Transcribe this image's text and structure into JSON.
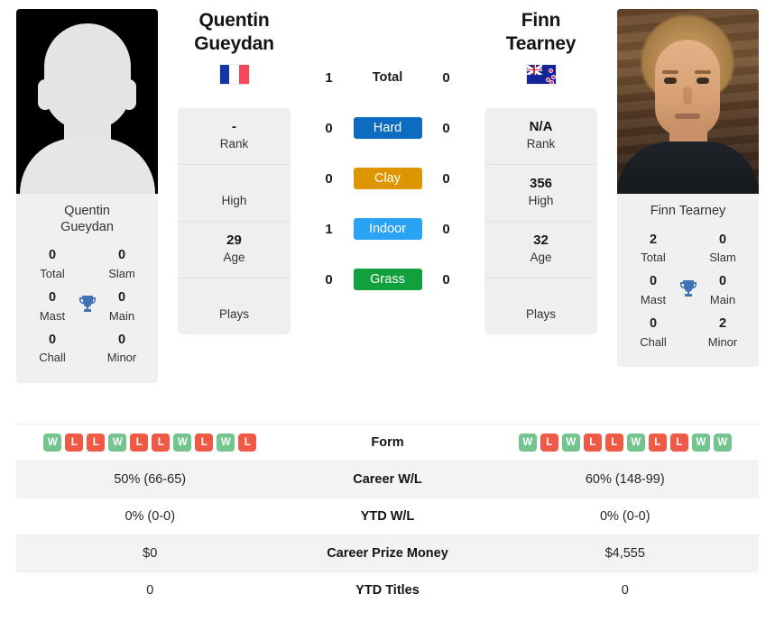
{
  "players": {
    "left": {
      "name": "Quentin Gueydan",
      "name_line1": "Quentin",
      "name_line2": "Gueydan",
      "photo_caption_line1": "Quentin",
      "photo_caption_line2": "Gueydan",
      "flag": "fr-flag-icon",
      "avatar": "placeholder-avatar-icon",
      "rank": "-",
      "rank_label": "Rank",
      "high": "",
      "high_label": "High",
      "age": "29",
      "age_label": "Age",
      "plays": "",
      "plays_label": "Plays",
      "titles": {
        "total": "0",
        "total_label": "Total",
        "slam": "0",
        "slam_label": "Slam",
        "mast": "0",
        "mast_label": "Mast",
        "main": "0",
        "main_label": "Main",
        "chall": "0",
        "chall_label": "Chall",
        "minor": "0",
        "minor_label": "Minor"
      },
      "titles_by_surface": {
        "total": "1",
        "hard": "0",
        "clay": "0",
        "indoor": "1",
        "grass": "0"
      },
      "form": [
        "W",
        "L",
        "L",
        "W",
        "L",
        "L",
        "W",
        "L",
        "W",
        "L"
      ],
      "career_wl": "50% (66-65)",
      "ytd_wl": "0% (0-0)",
      "career_prize_money": "$0",
      "ytd_titles": "0"
    },
    "right": {
      "name": "Finn Tearney",
      "name_line1": "Finn Tearney",
      "name_line2": "",
      "photo_caption_line1": "Finn Tearney",
      "photo_caption_line2": "",
      "flag": "nz-flag-icon",
      "avatar": "player-photo",
      "rank": "N/A",
      "rank_label": "Rank",
      "high": "356",
      "high_label": "High",
      "age": "32",
      "age_label": "Age",
      "plays": "",
      "plays_label": "Plays",
      "titles": {
        "total": "2",
        "total_label": "Total",
        "slam": "0",
        "slam_label": "Slam",
        "mast": "0",
        "mast_label": "Mast",
        "main": "0",
        "main_label": "Main",
        "chall": "0",
        "chall_label": "Chall",
        "minor": "2",
        "minor_label": "Minor"
      },
      "titles_by_surface": {
        "total": "0",
        "hard": "0",
        "clay": "0",
        "indoor": "0",
        "grass": "0"
      },
      "form": [
        "W",
        "L",
        "W",
        "L",
        "L",
        "W",
        "L",
        "L",
        "W",
        "W"
      ],
      "career_wl": "60% (148-99)",
      "ytd_wl": "0% (0-0)",
      "career_prize_money": "$4,555",
      "ytd_titles": "0"
    }
  },
  "surface_rows": [
    {
      "key": "total",
      "label": "Total",
      "color": "",
      "plain": true
    },
    {
      "key": "hard",
      "label": "Hard",
      "color": "#0d6cc0",
      "plain": false
    },
    {
      "key": "clay",
      "label": "Clay",
      "color": "#dd9500",
      "plain": false
    },
    {
      "key": "indoor",
      "label": "Indoor",
      "color": "#2aa3f5",
      "plain": false
    },
    {
      "key": "grass",
      "label": "Grass",
      "color": "#12a03c",
      "plain": false
    }
  ],
  "stats_table": [
    {
      "label": "Form",
      "key": "form",
      "type": "form"
    },
    {
      "label": "Career W/L",
      "key": "career_wl",
      "type": "text"
    },
    {
      "label": "YTD W/L",
      "key": "ytd_wl",
      "type": "text"
    },
    {
      "label": "Career Prize Money",
      "key": "career_prize_money",
      "type": "text"
    },
    {
      "label": "YTD Titles",
      "key": "ytd_titles",
      "type": "text"
    }
  ],
  "colors": {
    "hard": "#0d6cc0",
    "clay": "#dd9500",
    "indoor": "#2aa3f5",
    "grass": "#12a03c",
    "win": "#73c48f",
    "loss": "#ef5a46",
    "trophy": "#3f73b8"
  },
  "icons": {
    "trophy": "🏆"
  }
}
